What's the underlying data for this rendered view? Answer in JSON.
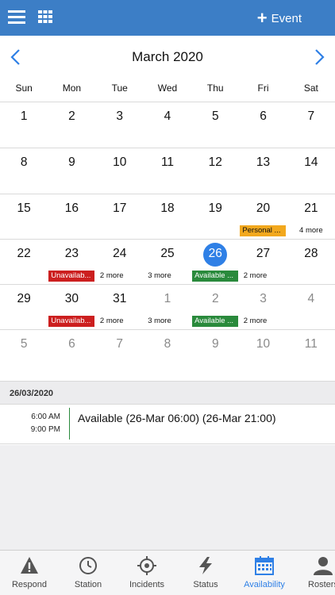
{
  "header": {
    "event_label": "Event",
    "icons": [
      "hamburger-menu-icon",
      "grid-icon",
      "plus-icon"
    ]
  },
  "calendar": {
    "month_title": "March 2020",
    "weekdays": [
      "Sun",
      "Mon",
      "Tue",
      "Wed",
      "Thu",
      "Fri",
      "Sat"
    ],
    "weeks": [
      [
        "1",
        "2",
        "3",
        "4",
        "5",
        "6",
        "7"
      ],
      [
        "8",
        "9",
        "10",
        "11",
        "12",
        "13",
        "14"
      ],
      [
        "15",
        "16",
        "17",
        "18",
        "19",
        "20",
        "21"
      ],
      [
        "22",
        "23",
        "24",
        "25",
        "26",
        "27",
        "28"
      ],
      [
        "29",
        "30",
        "31",
        "1",
        "2",
        "3",
        "4"
      ],
      [
        "5",
        "6",
        "7",
        "8",
        "9",
        "10",
        "11"
      ]
    ],
    "today": "26",
    "events": {
      "w3_personal": "Personal ...",
      "w3_more": "4 more",
      "w4_unavailable": "Unavailab...",
      "w4_more_mon": "2 more",
      "w4_more_tue": "3 more",
      "w4_available": "Available ...",
      "w4_more_thu": "2 more",
      "w5_unavailable": "Unavailab...",
      "w5_more_mon": "2 more",
      "w5_more_tue": "3 more",
      "w5_available": "Available ...",
      "w5_more_thu": "2 more"
    },
    "colors": {
      "today": "#2f80e6",
      "unavailable": "#cc1f1f",
      "available": "#2a8a3c",
      "personal": "#f2a81d",
      "header": "#3c7ec6"
    }
  },
  "agenda": {
    "date": "26/03/2020",
    "event": {
      "start": "6:00 AM",
      "end": "9:00 PM",
      "title": "Available (26-Mar 06:00) (26-Mar 21:00)"
    }
  },
  "tabs": [
    {
      "label": "Respond",
      "icon": "warning-icon"
    },
    {
      "label": "Station",
      "icon": "clock-icon"
    },
    {
      "label": "Incidents",
      "icon": "target-icon"
    },
    {
      "label": "Status",
      "icon": "lightning-icon"
    },
    {
      "label": "Availability",
      "icon": "calendar-icon"
    },
    {
      "label": "Rosters",
      "icon": "person-icon"
    }
  ]
}
